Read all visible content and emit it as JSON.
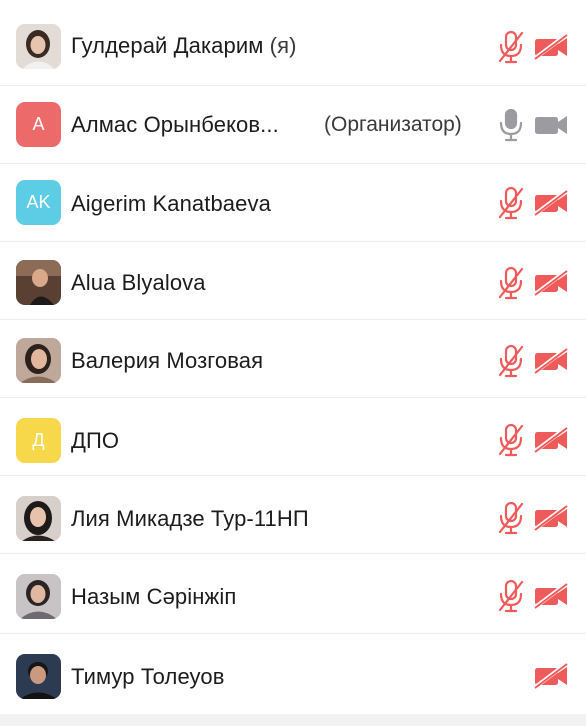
{
  "participants": [
    {
      "name": "Гулдерай Дакарим",
      "suffix": " (я)",
      "role": "",
      "avatar_initials": "",
      "avatar_color": "#d9d3cd",
      "mic": "muted",
      "camera": "off"
    },
    {
      "name": "Алмас Орынбеков...",
      "suffix": "",
      "role": "(Организатор)",
      "avatar_initials": "А",
      "avatar_color": "#ec6a6a",
      "mic": "on",
      "camera": "on"
    },
    {
      "name": "Aigerim Kanatbaeva",
      "suffix": "",
      "role": "",
      "avatar_initials": "AK",
      "avatar_color": "#5ccde4",
      "mic": "muted",
      "camera": "off"
    },
    {
      "name": "Alua Blyalova",
      "suffix": "",
      "role": "",
      "avatar_initials": "",
      "avatar_color": "#3d2a22",
      "mic": "muted",
      "camera": "off"
    },
    {
      "name": "Валерия Мозговая",
      "suffix": "",
      "role": "",
      "avatar_initials": "",
      "avatar_color": "#a48a7c",
      "mic": "muted",
      "camera": "off"
    },
    {
      "name": "ДПО",
      "suffix": "",
      "role": "",
      "avatar_initials": "Д",
      "avatar_color": "#f6d84a",
      "mic": "muted",
      "camera": "off"
    },
    {
      "name": "Лия Микадзе Тур-11НП",
      "suffix": "",
      "role": "",
      "avatar_initials": "",
      "avatar_color": "#5a4a44",
      "mic": "muted",
      "camera": "off"
    },
    {
      "name": "Назым Сәрінжіп",
      "suffix": "",
      "role": "",
      "avatar_initials": "",
      "avatar_color": "#8f8a8c",
      "mic": "muted",
      "camera": "off"
    },
    {
      "name": "Тимур Толеуов",
      "suffix": "",
      "role": "",
      "avatar_initials": "",
      "avatar_color": "#2c3a52",
      "mic": "none",
      "camera": "off"
    }
  ],
  "colors": {
    "muted_red": "#ef5b5b",
    "active_gray": "#9c9ca0",
    "text": "#1c1c1e",
    "divider": "#ececee"
  },
  "icons": {
    "mic_muted": "mic-muted-icon",
    "mic_on": "mic-icon",
    "camera_off": "camera-off-icon",
    "camera_on": "camera-icon"
  }
}
